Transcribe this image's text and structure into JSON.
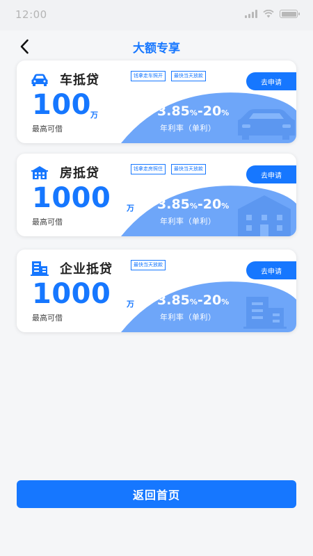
{
  "status_bar": {
    "time": "12:00"
  },
  "header": {
    "title": "大额专享"
  },
  "colors": {
    "accent": "#1677ff",
    "curve": "#6ea6f9",
    "icon_fill": "#5c97f0"
  },
  "loans": [
    {
      "name": "车抵贷",
      "icon": "car-icon",
      "tags": [
        "钱拿走车照开",
        "最快当天放款"
      ],
      "apply_label": "去申请",
      "amount": "100",
      "amount_unit": "万",
      "amount_caption": "最高可借",
      "rate_value": "3.85",
      "rate_pct1": "%",
      "rate_dash": "-20",
      "rate_pct2": "%",
      "rate_caption": "年利率（单利）"
    },
    {
      "name": "房抵贷",
      "icon": "building-icon",
      "tags": [
        "钱拿走房照住",
        "最快当天放款"
      ],
      "apply_label": "去申请",
      "amount": "1000",
      "amount_unit": "万",
      "amount_caption": "最高可借",
      "rate_value": "3.85",
      "rate_pct1": "%",
      "rate_dash": "-20",
      "rate_pct2": "%",
      "rate_caption": "年利率（单利）"
    },
    {
      "name": "企业抵贷",
      "icon": "office-icon",
      "tags": [
        "最快当天放款"
      ],
      "apply_label": "去申请",
      "amount": "1000",
      "amount_unit": "万",
      "amount_caption": "最高可借",
      "rate_value": "3.85",
      "rate_pct1": "%",
      "rate_dash": "-20",
      "rate_pct2": "%",
      "rate_caption": "年利率（单利）"
    }
  ],
  "footer": {
    "home_button_label": "返回首页"
  }
}
